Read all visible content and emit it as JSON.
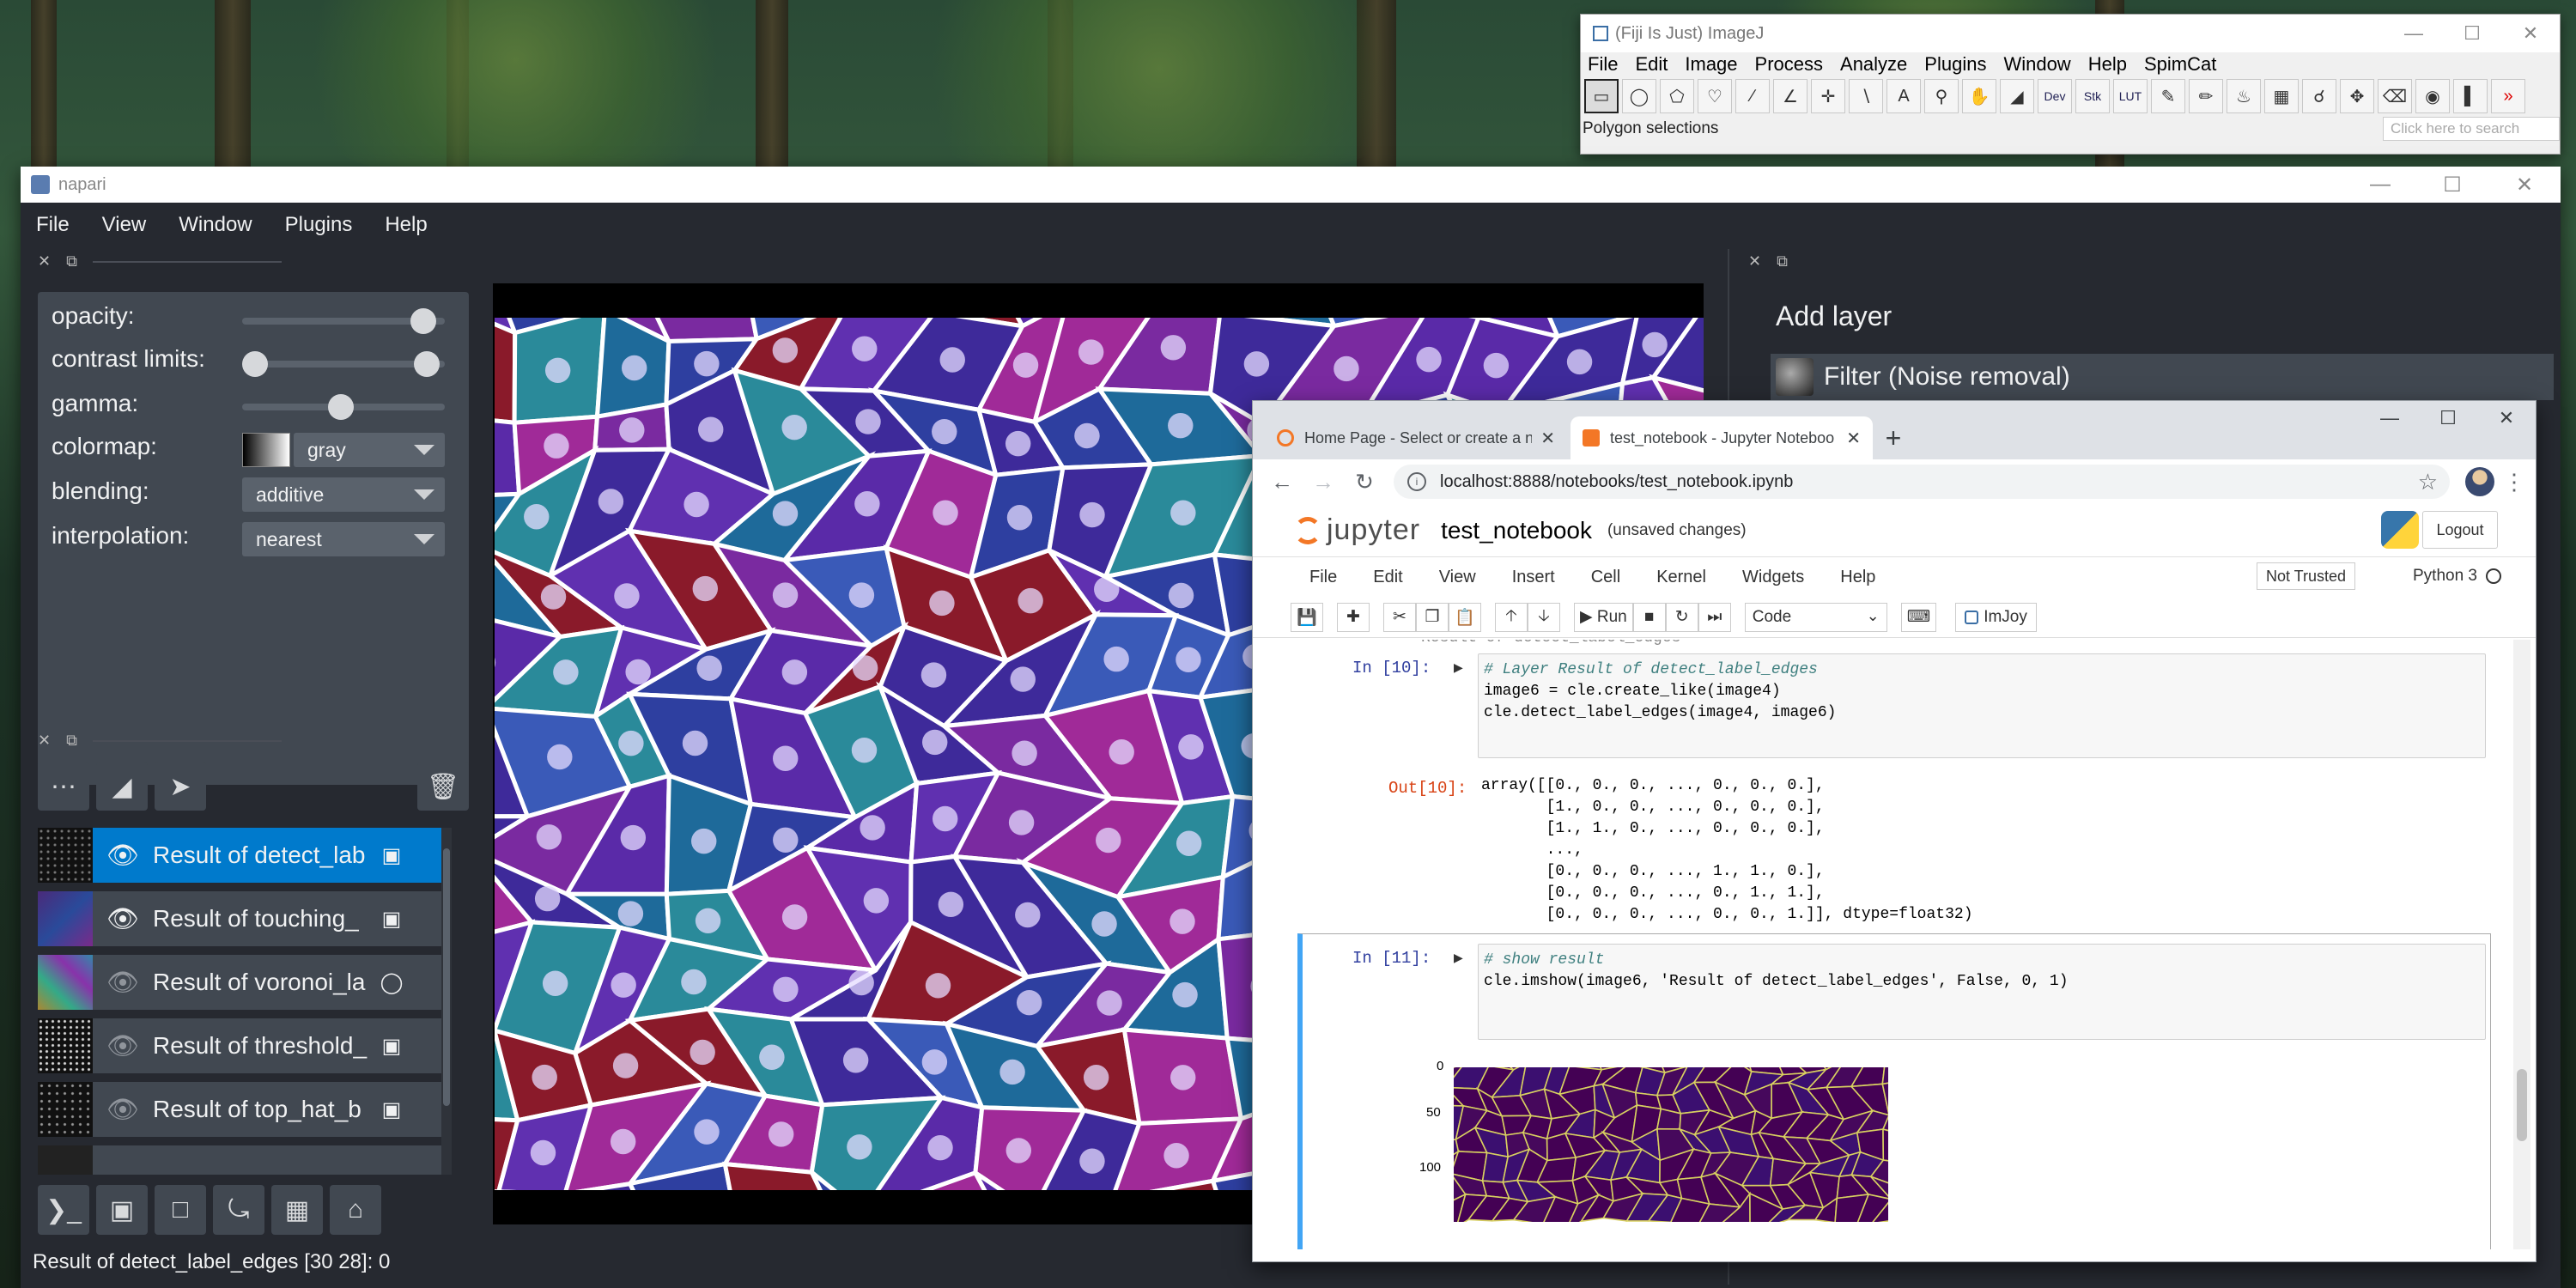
{
  "imagej": {
    "title": "(Fiji Is Just) ImageJ",
    "menu": [
      "File",
      "Edit",
      "Image",
      "Process",
      "Analyze",
      "Plugins",
      "Window",
      "Help",
      "SpimCat"
    ],
    "tool_labels": {
      "dev": "Dev",
      "stk": "Stk",
      "lut": "LUT",
      "text": "A"
    },
    "status": "Polygon selections",
    "search_placeholder": "Click here to search"
  },
  "napari": {
    "title": "napari",
    "menu": [
      "File",
      "View",
      "Window",
      "Plugins",
      "Help"
    ],
    "controls": {
      "opacity_label": "opacity:",
      "contrast_label": "contrast limits:",
      "gamma_label": "gamma:",
      "colormap_label": "colormap:",
      "colormap_value": "gray",
      "blending_label": "blending:",
      "blending_value": "additive",
      "interpolation_label": "interpolation:",
      "interpolation_value": "nearest"
    },
    "layers": [
      {
        "name": "Result of detect_lab",
        "visible": true,
        "selected": true,
        "type_icon": "image-icon"
      },
      {
        "name": "Result of touching_",
        "visible": true,
        "selected": false,
        "type_icon": "image-icon"
      },
      {
        "name": "Result of voronoi_la",
        "visible": false,
        "selected": false,
        "type_icon": "labels-icon"
      },
      {
        "name": "Result of threshold_",
        "visible": false,
        "selected": false,
        "type_icon": "image-icon"
      },
      {
        "name": "Result of top_hat_b",
        "visible": false,
        "selected": false,
        "type_icon": "image-icon"
      }
    ],
    "status_bar": "Result of detect_label_edges [30 28]: 0",
    "add_layer_title": "Add layer",
    "filter_item": "Filter (Noise removal)"
  },
  "browser": {
    "tabs": [
      {
        "title": "Home Page - Select or create a n",
        "active": false
      },
      {
        "title": "test_notebook - Jupyter Noteboo",
        "active": true
      }
    ],
    "url": "localhost:8888/notebooks/test_notebook.ipynb"
  },
  "jupyter": {
    "logo_text": "jupyter",
    "notebook_name": "test_notebook",
    "save_status": "(unsaved changes)",
    "logout_label": "Logout",
    "menu": [
      "File",
      "Edit",
      "View",
      "Insert",
      "Cell",
      "Kernel",
      "Widgets",
      "Help"
    ],
    "trust_label": "Not Trusted",
    "kernel_name": "Python 3",
    "run_label": "Run",
    "cell_type": "Code",
    "imjoy_label": "ImJoy",
    "faded_line": "Result of detect_label_edges",
    "cell10": {
      "prompt_in": "In [10]:",
      "prompt_out": "Out[10]:",
      "code": [
        "# Layer Result of detect_label_edges",
        "image6 = cle.create_like(image4)",
        "cle.detect_label_edges(image4, image6)"
      ],
      "output": [
        "array([[0., 0., 0., ..., 0., 0., 0.],",
        "       [1., 0., 0., ..., 0., 0., 0.],",
        "       [1., 1., 0., ..., 0., 0., 0.],",
        "       ...,",
        "       [0., 0., 0., ..., 1., 1., 0.],",
        "       [0., 0., 0., ..., 0., 1., 1.],",
        "       [0., 0., 0., ..., 0., 0., 1.]], dtype=float32)"
      ]
    },
    "cell11": {
      "prompt_in": "In [11]:",
      "code": [
        "# show result",
        "cle.imshow(image6, 'Result of detect_label_edges', False, 0, 1)"
      ]
    },
    "plot_ticks": [
      "0",
      "50",
      "100"
    ]
  },
  "colors": {
    "napari_bg": "#262930",
    "napari_panel": "#414851",
    "napari_accent": "#007acc",
    "jupyter_orange": "#f37726",
    "jupyter_cell_selected": "#42a5f5"
  }
}
